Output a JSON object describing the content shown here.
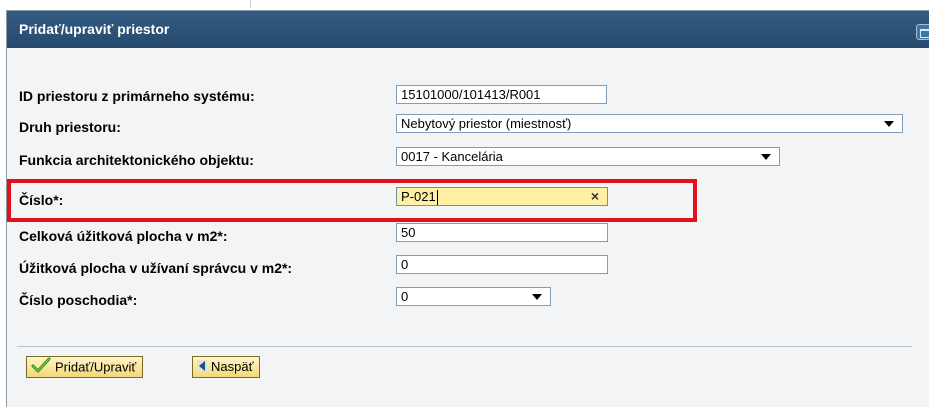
{
  "dialog": {
    "title": "Pridať/upraviť priestor"
  },
  "form": {
    "id_label": "ID priestoru z primárneho systému:",
    "id_value": "15101000/101413/R001",
    "druh_label": "Druh priestoru:",
    "druh_value": "Nebytový priestor (miestnosť)",
    "funkcia_label": "Funkcia architektonického objektu:",
    "funkcia_value": "0017 - Kancelária",
    "cislo_label": "Číslo*:",
    "cislo_value": "P-021",
    "plocha_label": "Celková úžitková plocha v m2*:",
    "plocha_value": "50",
    "uziv_label": "Úžitková plocha v užívaní správcu v m2*:",
    "uziv_value": "0",
    "poschodie_label": "Číslo poschodia*:",
    "poschodie_value": "0"
  },
  "buttons": {
    "add_label": "Pridať/Upraviť",
    "back_label": "Naspäť"
  },
  "icons": {
    "maximize": "maximize-icon",
    "clear": "clear-x-icon",
    "dropdown": "dropdown-arrow-icon",
    "check": "checkmark-icon",
    "back": "back-arrow-icon"
  },
  "colors": {
    "titlebar": "#2d5479",
    "highlight_field": "#fff0a6",
    "annotation_red": "#e1111a",
    "button_gold": "#f3d77a"
  }
}
